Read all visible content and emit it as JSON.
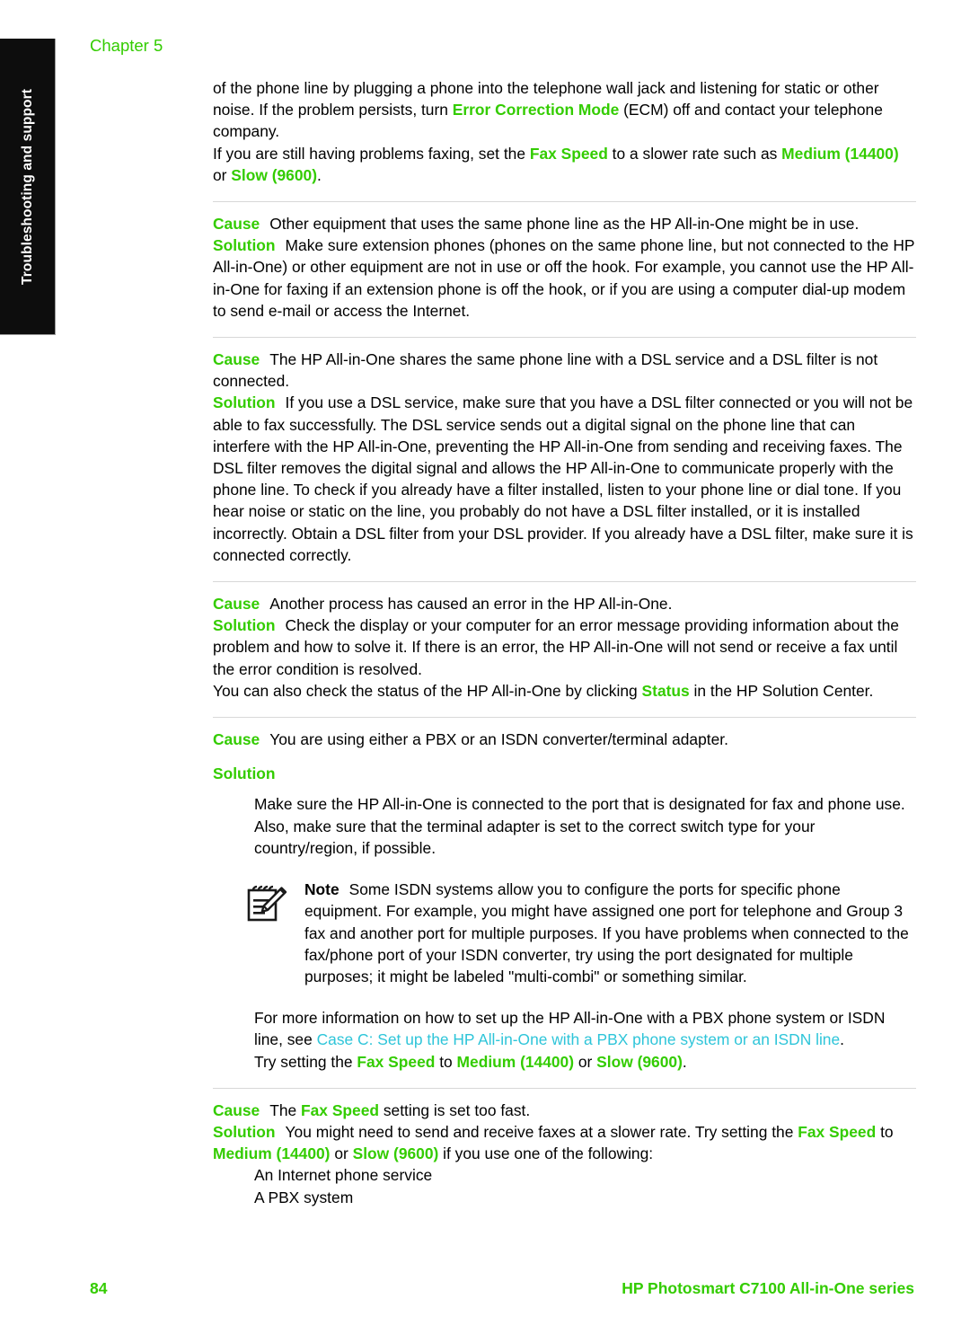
{
  "page": {
    "chapter_head": "Chapter 5",
    "side_tab_label": "Troubleshooting and support",
    "folio": "84",
    "footer_title": "HP Photosmart C7100 All-in-One series",
    "accent_green": "#33cc00",
    "xref_cyan": "#2ec5d9",
    "tab_background": "#0d0d0d",
    "rule_color": "#d8d8d8"
  },
  "labels": {
    "cause": "Cause",
    "solution": "Solution",
    "note": "Note"
  },
  "intro": {
    "para1_a": "of the phone line by plugging a phone into the telephone wall jack and listening for static or other noise. If the problem persists, turn ",
    "para1_kw": "Error Correction Mode",
    "para1_b": " (ECM) off and contact your telephone company.",
    "para2_a": "If you are still having problems faxing, set the ",
    "para2_kw1": "Fax Speed",
    "para2_b": " to a slower rate such as ",
    "para2_kw2": "Medium (14400)",
    "para2_c": " or ",
    "para2_kw3": "Slow (9600)",
    "para2_d": "."
  },
  "blocks": [
    {
      "cause_text": "Other equipment that uses the same phone line as the HP All-in-One might be in use.",
      "solution_text": "Make sure extension phones (phones on the same phone line, but not connected to the HP All-in-One) or other equipment are not in use or off the hook. For example, you cannot use the HP All-in-One for faxing if an extension phone is off the hook, or if you are using a computer dial-up modem to send e-mail or access the Internet."
    },
    {
      "cause_text": "The HP All-in-One shares the same phone line with a DSL service and a DSL filter is not connected.",
      "solution_text": "If you use a DSL service, make sure that you have a DSL filter connected or you will not be able to fax successfully. The DSL service sends out a digital signal on the phone line that can interfere with the HP All-in-One, preventing the HP All-in-One from sending and receiving faxes. The DSL filter removes the digital signal and allows the HP All-in-One to communicate properly with the phone line. To check if you already have a filter installed, listen to your phone line or dial tone. If you hear noise or static on the line, you probably do not have a DSL filter installed, or it is installed incorrectly. Obtain a DSL filter from your DSL provider. If you already have a DSL filter, make sure it is connected correctly."
    },
    {
      "cause_text": "Another process has caused an error in the HP All-in-One.",
      "solution_text": "Check the display or your computer for an error message providing information about the problem and how to solve it. If there is an error, the HP All-in-One will not send or receive a fax until the error condition is resolved.",
      "extra_a": "You can also check the status of the HP All-in-One by clicking ",
      "extra_kw": "Status",
      "extra_b": " in the HP Solution Center."
    }
  ],
  "pbx_block": {
    "cause_text": "You are using either a PBX or an ISDN converter/terminal adapter.",
    "solution_body": "Make sure the HP All-in-One is connected to the port that is designated for fax and phone use. Also, make sure that the terminal adapter is set to the correct switch type for your country/region, if possible.",
    "note_text": "Some ISDN systems allow you to configure the ports for specific phone equipment. For example, you might have assigned one port for telephone and Group 3 fax and another port for multiple purposes. If you have problems when connected to the fax/phone port of your ISDN converter, try using the port designated for multiple purposes; it might be labeled \"multi-combi\" or something similar.",
    "xref_a": "For more information on how to set up the HP All-in-One with a PBX phone system or ISDN line, see ",
    "xref_link": "Case C: Set up the HP All-in-One with a PBX phone system or an ISDN line",
    "xref_b": ".",
    "try_a": "Try setting the ",
    "try_kw1": "Fax Speed",
    "try_b": " to ",
    "try_kw2": "Medium (14400)",
    "try_c": " or ",
    "try_kw3": "Slow (9600)",
    "try_d": "."
  },
  "speed_block": {
    "cause_a": "The ",
    "cause_kw": "Fax Speed",
    "cause_b": " setting is set too fast.",
    "solution_a": "You might need to send and receive faxes at a slower rate. Try setting the ",
    "solution_kw1": "Fax Speed",
    "solution_b": " to ",
    "solution_kw2": "Medium (14400)",
    "solution_c": " or ",
    "solution_kw3": "Slow (9600)",
    "solution_d": " if you use one of the following:",
    "items": [
      "An Internet phone service",
      "A PBX system"
    ]
  }
}
